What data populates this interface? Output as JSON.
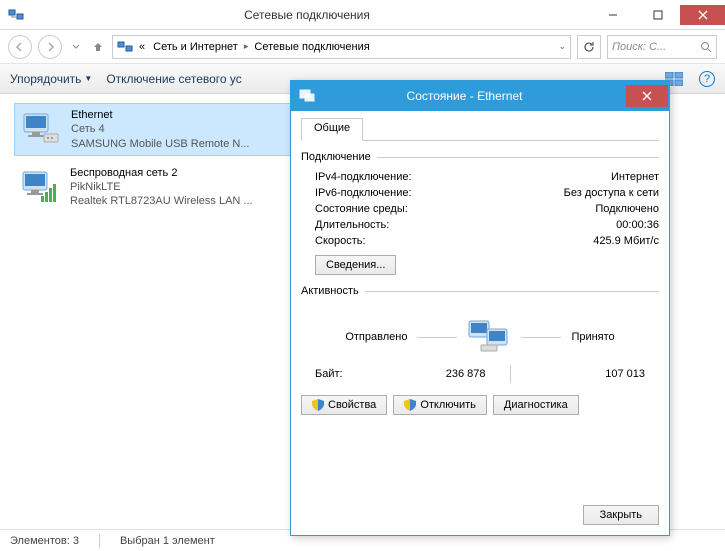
{
  "window": {
    "title": "Сетевые подключения"
  },
  "path": {
    "prefix": "«",
    "seg1": "Сеть и Интернет",
    "seg2": "Сетевые подключения"
  },
  "search": {
    "placeholder": "Поиск: С..."
  },
  "toolbar": {
    "organize": "Упорядочить",
    "disable": "Отключение сетевого ус"
  },
  "connections": [
    {
      "name": "Ethernet",
      "sub": "Сеть  4",
      "dev": "SAMSUNG Mobile USB Remote N..."
    },
    {
      "name": "Беспроводная сеть 2",
      "sub": "PikNikLTE",
      "dev": "Realtek RTL8723AU Wireless LAN ..."
    }
  ],
  "status": {
    "count": "Элементов: 3",
    "selected": "Выбран 1 элемент"
  },
  "dialog": {
    "title": "Состояние - Ethernet",
    "tab": "Общие",
    "group_conn": "Подключение",
    "rows": {
      "ipv4_k": "IPv4-подключение:",
      "ipv4_v": "Интернет",
      "ipv6_k": "IPv6-подключение:",
      "ipv6_v": "Без доступа к сети",
      "media_k": "Состояние среды:",
      "media_v": "Подключено",
      "dur_k": "Длительность:",
      "dur_v": "00:00:36",
      "speed_k": "Скорость:",
      "speed_v": "425.9 Мбит/с"
    },
    "details_btn": "Сведения...",
    "group_act": "Активность",
    "sent": "Отправлено",
    "recv": "Принято",
    "bytes_lbl": "Байт:",
    "bytes_sent": "236 878",
    "bytes_recv": "107 013",
    "btn_props": "Свойства",
    "btn_disable": "Отключить",
    "btn_diag": "Диагностика",
    "btn_close": "Закрыть"
  }
}
